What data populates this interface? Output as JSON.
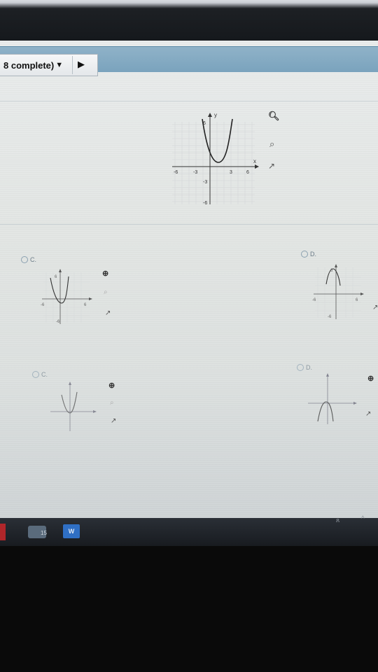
{
  "header": {
    "progress_label": "8 complete)",
    "dropdown_glyph": "▼",
    "next_glyph": "▶"
  },
  "question_graph": {
    "y_label": "y",
    "x_label": "x",
    "y_top": "6",
    "y_neg3": "-3",
    "y_neg6": "-6",
    "x_neg6": "-6",
    "x_neg3": "-3",
    "x_3": "3",
    "x_6": "6"
  },
  "options": [
    {
      "letter": "C."
    },
    {
      "letter": "D."
    },
    {
      "letter": "C."
    },
    {
      "letter": "D."
    }
  ],
  "thumb_labels": {
    "y_top": "6",
    "x_neg": "-6",
    "x_pos": "6",
    "y_neg": "-6"
  },
  "tools": {
    "zoom_in_icon": "zoom-in-icon",
    "zoom_out_icon": "zoom-out-icon",
    "popout_icon": "popout-icon"
  },
  "taskbar": {
    "badge": "15",
    "word_label": "W",
    "tray_text": "ጸ",
    "chevron": "^"
  }
}
